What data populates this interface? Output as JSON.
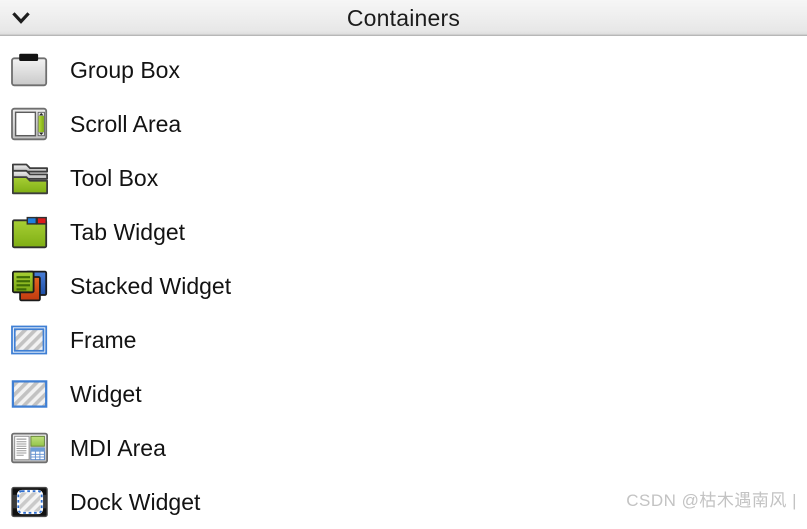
{
  "header": {
    "title": "Containers",
    "collapse_icon": "chevron-down-icon"
  },
  "list": {
    "items": [
      {
        "label": "Group Box",
        "icon": "group-box-icon"
      },
      {
        "label": "Scroll Area",
        "icon": "scroll-area-icon"
      },
      {
        "label": "Tool Box",
        "icon": "tool-box-icon"
      },
      {
        "label": "Tab Widget",
        "icon": "tab-widget-icon"
      },
      {
        "label": "Stacked Widget",
        "icon": "stacked-widget-icon"
      },
      {
        "label": "Frame",
        "icon": "frame-icon"
      },
      {
        "label": "Widget",
        "icon": "widget-icon"
      },
      {
        "label": "MDI Area",
        "icon": "mdi-area-icon"
      },
      {
        "label": "Dock Widget",
        "icon": "dock-widget-icon"
      }
    ]
  },
  "watermark": {
    "text": "CSDN @枯木遇南风 |"
  },
  "colors": {
    "header_top": "#f6f6f6",
    "header_bottom": "#dcdcdc",
    "header_border": "#b7b7b7",
    "text": "#131313",
    "icon_green": "#8dbe2a",
    "icon_blue": "#2f6fd0",
    "icon_red": "#d62020",
    "icon_orange": "#d4541c",
    "frame_blue": "#3a7ad6",
    "watermark": "#c3c3c3"
  }
}
